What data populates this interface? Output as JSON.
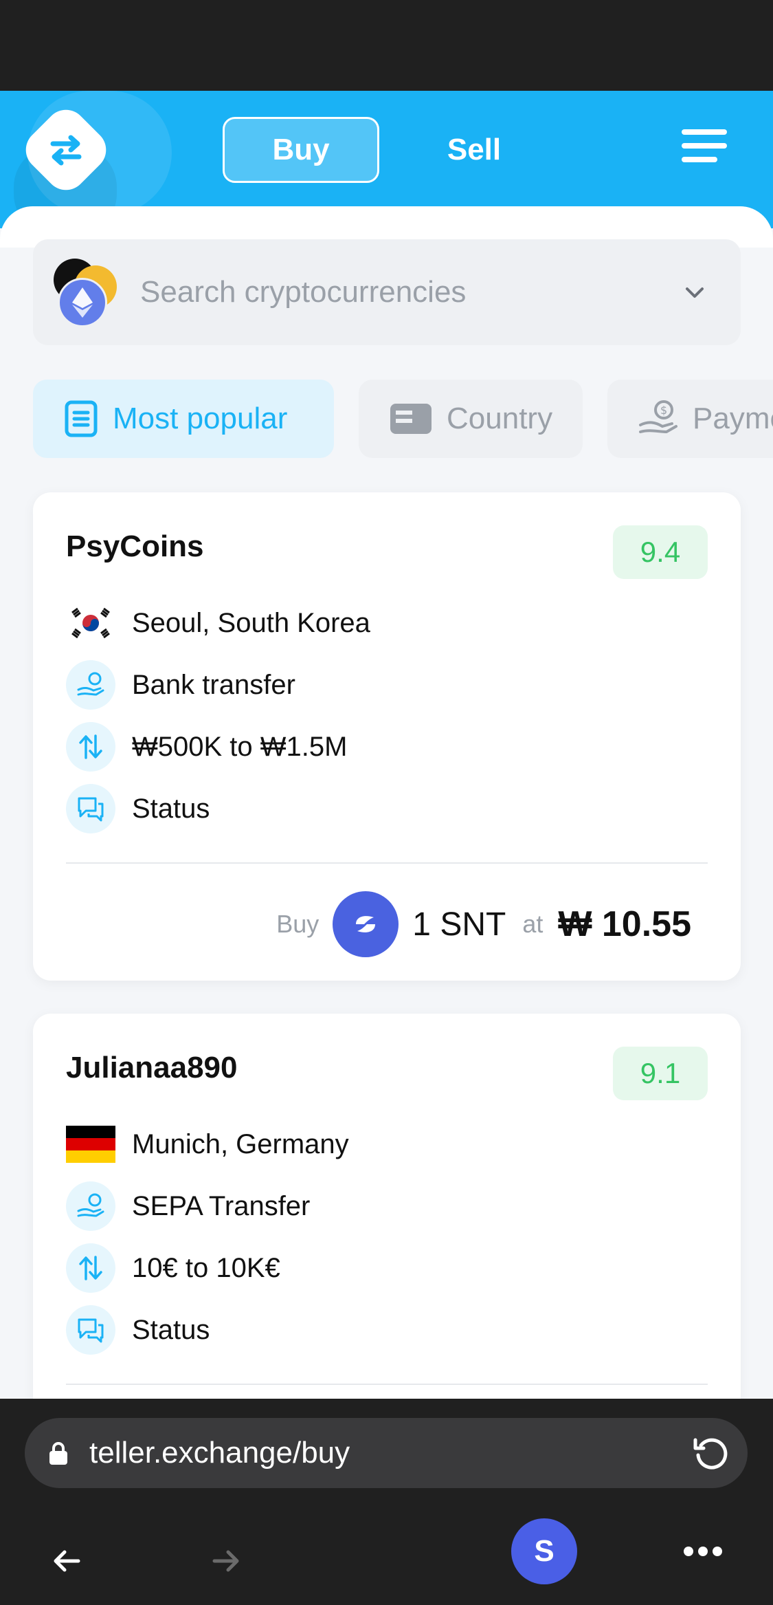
{
  "header": {
    "logo_icon": "exchange-arrows-icon",
    "tabs": {
      "buy": "Buy",
      "sell": "Sell"
    },
    "menu_icon": "hamburger-icon"
  },
  "search": {
    "placeholder": "Search cryptocurrencies",
    "icon": "crypto-coins-icon"
  },
  "filters": [
    {
      "label": "Most popular",
      "icon": "list-icon"
    },
    {
      "label": "Country",
      "icon": "id-card-icon"
    },
    {
      "label": "Payment",
      "icon": "hand-coin-icon"
    }
  ],
  "offers": [
    {
      "name": "PsyCoins",
      "score": "9.4",
      "location": "Seoul, South Korea",
      "payment": "Bank transfer",
      "limits": "₩500K to ₩1.5M",
      "status": "Status",
      "buy_label": "Buy",
      "amount": "1 SNT",
      "at_label": "at",
      "price": "₩ 10.55"
    },
    {
      "name": "Julianaa890",
      "score": "9.1",
      "location": "Munich, Germany",
      "payment": "SEPA Transfer",
      "limits": "10€ to 10K€",
      "status": "Status"
    }
  ],
  "browser": {
    "url": "teller.exchange/buy",
    "profile_initial": "S"
  },
  "colors": {
    "brand": "#1ab2f5",
    "score_green": "#35c463",
    "snt_blue": "#4a62e0"
  }
}
